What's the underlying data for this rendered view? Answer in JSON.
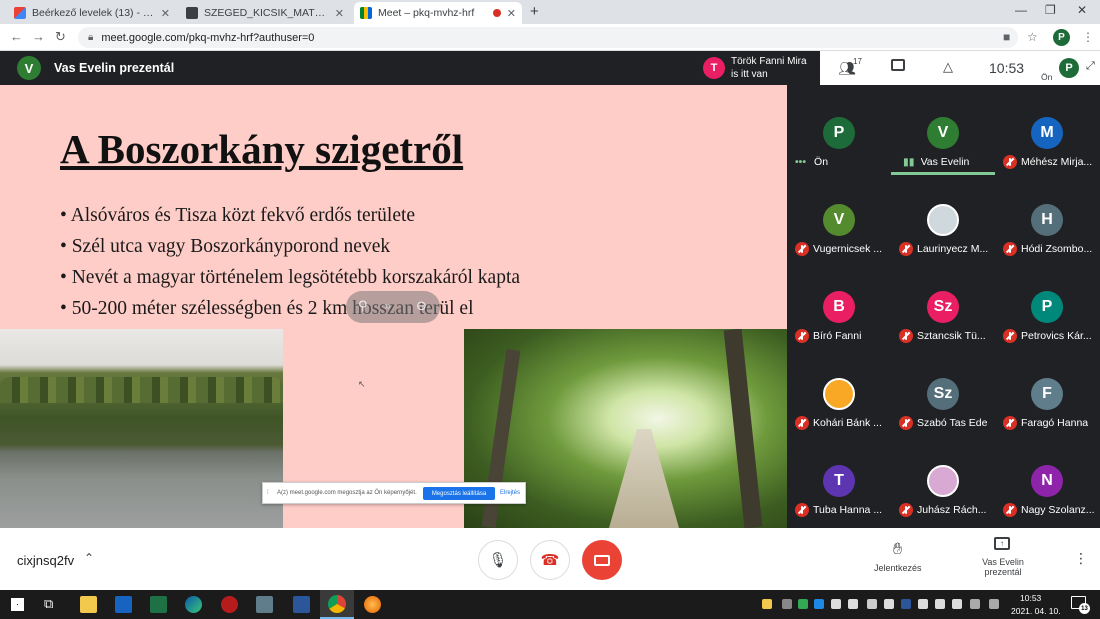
{
  "browser": {
    "tabs": [
      {
        "title": "Beérkező levelek (13) - szabone...",
        "active": false
      },
      {
        "title": "SZEGED_KICSIK_MATEK_SZ3_2021",
        "active": false
      },
      {
        "title": "Meet – pkq-mvhz-hrf",
        "active": true
      }
    ],
    "new_tab": "+",
    "url": "meet.google.com/pkq-mvhz-hrf?authuser=0",
    "profile": "P"
  },
  "meet": {
    "presenter_initial": "V",
    "presenter_label": "Vas Evelin prezentál",
    "toast": {
      "initial": "T",
      "line1": "Török Fanni Mira",
      "line2": "is itt van"
    },
    "participants_count": "17",
    "clock": "10:53",
    "self_label": "Ön",
    "self_initial": "P",
    "meeting_code": "cixjnsq2fv",
    "raise_hand_label": "Jelentkezés",
    "present_label_1": "Vas Evelin",
    "present_label_2": "prezentál",
    "share_notice": {
      "text": "A(z) meet.google.com megosztja az Ön képernyőjét.",
      "stop_button": "Megosztás leállítása",
      "hide_button": "Elrejtés"
    }
  },
  "slide": {
    "title": "A Boszorkány szigetről",
    "bullets": [
      "Alsóváros és Tisza közt fekvő erdős területe",
      "Szél utca vagy Boszorkányporond nevek",
      "Nevét a magyar történelem legsötétebb korszakáról kapta",
      "50-200 méter szélességben és 2 km hosszan terül el"
    ]
  },
  "participants": [
    {
      "initial": "P",
      "name": "Ön",
      "color": "#1e6b3a",
      "state": "dots"
    },
    {
      "initial": "V",
      "name": "Vas Evelin",
      "color": "#2e7d32",
      "state": "speaking"
    },
    {
      "initial": "M",
      "name": "Méhész Mirja...",
      "color": "#1565c0",
      "state": "muted"
    },
    {
      "initial": "V",
      "name": "Vugernicsek ...",
      "color": "#558b2f",
      "state": "muted"
    },
    {
      "initial": "",
      "name": "Laurinyecz M...",
      "color": "#cfd8dc",
      "state": "muted"
    },
    {
      "initial": "H",
      "name": "Hódi Zsombo...",
      "color": "#546e7a",
      "state": "muted"
    },
    {
      "initial": "B",
      "name": "Bíró Fanni",
      "color": "#e91e63",
      "state": "muted"
    },
    {
      "initial": "Sz",
      "name": "Sztancsik Tü...",
      "color": "#e91e63",
      "state": "muted"
    },
    {
      "initial": "P",
      "name": "Petrovics Kár...",
      "color": "#00897b",
      "state": "muted"
    },
    {
      "initial": "",
      "name": "Kohári Bánk ...",
      "color": "#f9a825",
      "state": "muted"
    },
    {
      "initial": "Sz",
      "name": "Szabó Tas Ede",
      "color": "#546e7a",
      "state": "muted"
    },
    {
      "initial": "F",
      "name": "Faragó Hanna",
      "color": "#607d8b",
      "state": "muted"
    },
    {
      "initial": "T",
      "name": "Tuba Hanna ...",
      "color": "#5e35b1",
      "state": "muted"
    },
    {
      "initial": "",
      "name": "Juhász Rách...",
      "color": "#d7a9d3",
      "state": "muted"
    },
    {
      "initial": "N",
      "name": "Nagy Szolanz...",
      "color": "#8e24aa",
      "state": "muted"
    }
  ],
  "taskbar": {
    "time": "10:53",
    "date": "2021. 04. 10.",
    "notif_count": "13"
  },
  "colors": {
    "slide_bg": "#ffcdc8",
    "meet_dark": "#202124",
    "end_call": "#ea4335",
    "accent_blue": "#1a73e8",
    "speaking_bar": "#81c995"
  }
}
